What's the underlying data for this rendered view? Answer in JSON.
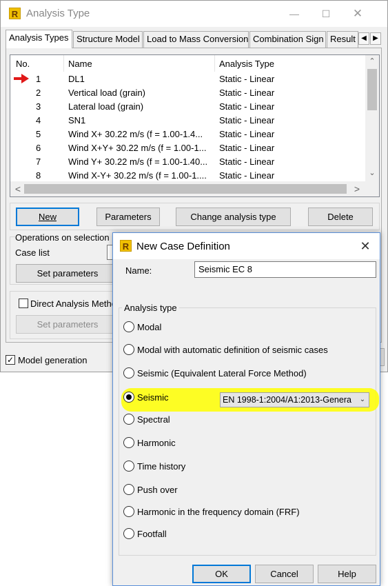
{
  "main_window": {
    "title": "Analysis Type",
    "logo_letter": "R",
    "tabs": [
      "Analysis Types",
      "Structure Model",
      "Load to Mass Conversion",
      "Combination Sign",
      "Result"
    ],
    "list": {
      "headers": {
        "no": "No.",
        "name": "Name",
        "type": "Analysis Type"
      },
      "rows": [
        {
          "no": "1",
          "name": "DL1",
          "type": "Static - Linear"
        },
        {
          "no": "2",
          "name": "Vertical load (grain)",
          "type": "Static - Linear"
        },
        {
          "no": "3",
          "name": "Lateral load (grain)",
          "type": "Static - Linear"
        },
        {
          "no": "4",
          "name": "SN1",
          "type": "Static - Linear"
        },
        {
          "no": "5",
          "name": "Wind X+ 30.22 m/s (f = 1.00-1.4...",
          "type": "Static - Linear"
        },
        {
          "no": "6",
          "name": "Wind X+Y+ 30.22 m/s (f = 1.00-1...",
          "type": "Static - Linear"
        },
        {
          "no": "7",
          "name": "Wind Y+ 30.22 m/s (f = 1.00-1.40...",
          "type": "Static - Linear"
        },
        {
          "no": "8",
          "name": "Wind X-Y+ 30.22 m/s (f = 1.00-1....",
          "type": "Static - Linear"
        }
      ]
    },
    "buttons": {
      "new": "New",
      "parameters": "Parameters",
      "change_type": "Change analysis type",
      "delete": "Delete"
    },
    "ops": {
      "group_label": "Operations on selection",
      "case_list_label": "Case list",
      "set_params": "Set parameters"
    },
    "direct": {
      "label": "Direct Analysis Method",
      "set_params": "Set parameters",
      "checked": false
    },
    "model_generation": {
      "label": "Model generation",
      "checked": true
    }
  },
  "dialog": {
    "title": "New Case Definition",
    "logo_letter": "R",
    "name_label": "Name:",
    "name_value": "Seismic EC 8",
    "group_label": "Analysis type",
    "options": [
      "Modal",
      "Modal with automatic definition of seismic cases",
      "Seismic (Equivalent Lateral Force Method)",
      "Seismic",
      "Spectral",
      "Harmonic",
      "Time history",
      "Push over",
      "Harmonic in the frequency domain (FRF)",
      "Footfall"
    ],
    "selected_option": "Seismic",
    "seismic_code": "EN 1998-1:2004/A1:2013-Genera",
    "buttons": {
      "ok": "OK",
      "cancel": "Cancel",
      "help": "Help"
    },
    "highlight_color": "#ffff00"
  }
}
